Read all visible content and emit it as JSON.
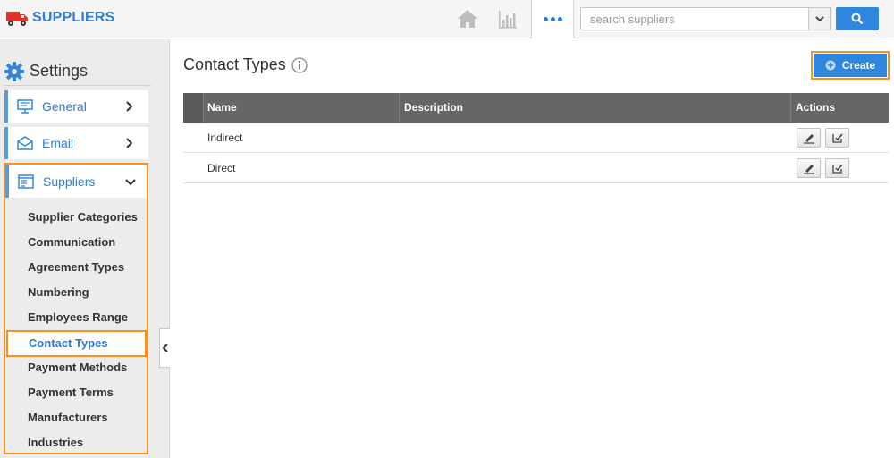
{
  "app": {
    "title": "SUPPLIERS"
  },
  "search": {
    "placeholder": "search suppliers",
    "value": ""
  },
  "sidebar": {
    "title": "Settings",
    "items": [
      {
        "label": "General",
        "icon": "monitor-icon"
      },
      {
        "label": "Email",
        "icon": "envelope-icon"
      },
      {
        "label": "Suppliers",
        "icon": "list-icon",
        "expanded": true
      }
    ],
    "sub_items": [
      "Supplier Categories",
      "Communication",
      "Agreement Types",
      "Numbering",
      "Employees Range",
      "Contact Types",
      "Payment Methods",
      "Payment Terms",
      "Manufacturers",
      "Industries"
    ],
    "active_sub_item": "Contact Types"
  },
  "main": {
    "title": "Contact Types",
    "create_label": "Create"
  },
  "table": {
    "columns": [
      "Name",
      "Description",
      "Actions"
    ],
    "rows": [
      {
        "name": "Indirect",
        "description": ""
      },
      {
        "name": "Direct",
        "description": ""
      }
    ]
  },
  "colors": {
    "brand": "#2e7bd6",
    "primary_button": "#2e86de",
    "highlight": "#f7931e",
    "table_header": "#666666"
  }
}
